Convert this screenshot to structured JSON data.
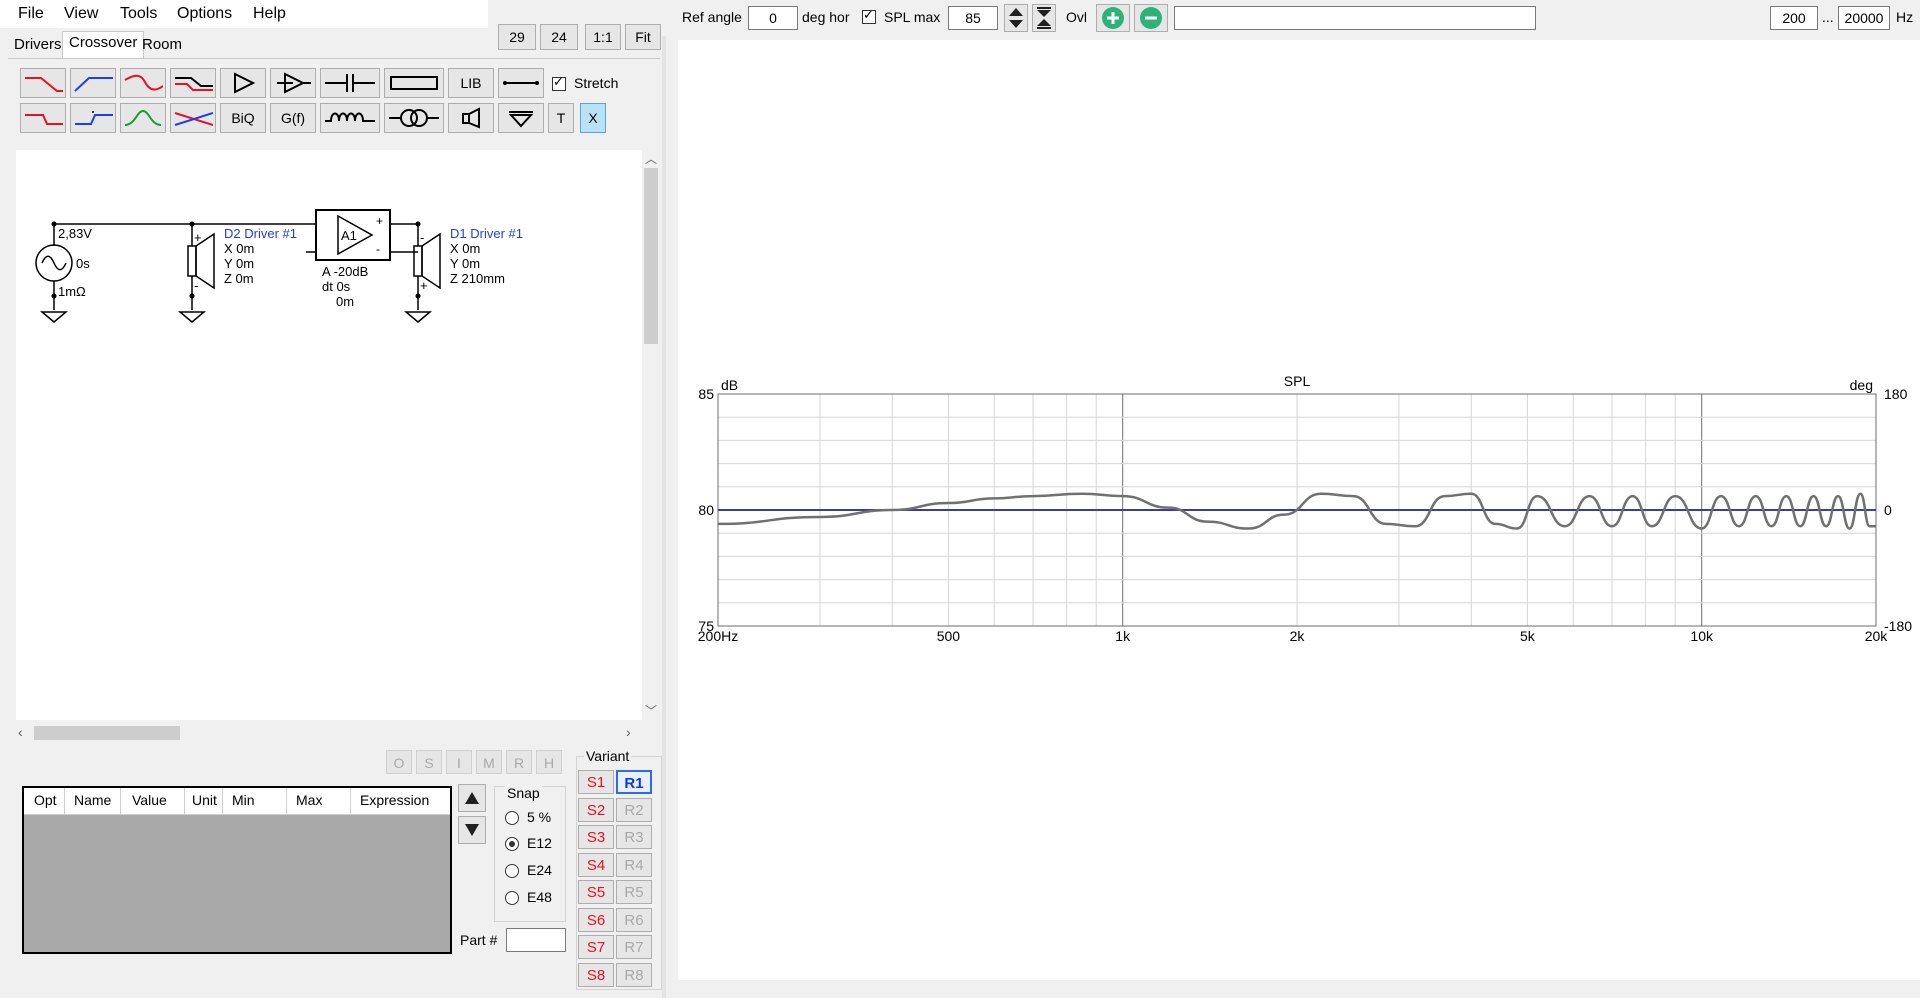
{
  "menu": [
    "File",
    "View",
    "Tools",
    "Options",
    "Help"
  ],
  "tabs": {
    "drivers": "Drivers",
    "crossover": "Crossover",
    "room": "Room"
  },
  "zoom": {
    "b1": "29",
    "b2": "24",
    "b3": "1:1",
    "b4": "Fit"
  },
  "toolbar": {
    "lib": "LIB",
    "biq": "BiQ",
    "gf": "G(f)",
    "t": "T",
    "x": "X",
    "stretch": "Stretch"
  },
  "schematic": {
    "source_v": "2,83V",
    "source_t": "0s",
    "source_r": "1mΩ",
    "d2_name": "D2 Driver #1",
    "d2_x": "X 0m",
    "d2_y": "Y 0m",
    "d2_z": "Z 0m",
    "amp_label": "A1",
    "amp_gain": "A  -20dB",
    "amp_dt": "dt 0s",
    "amp_d": "0m",
    "d1_name": "D1 Driver #1",
    "d1_x": "X 0m",
    "d1_y": "Y 0m",
    "d1_z": "Z 210mm",
    "plus": "+",
    "minus": "-"
  },
  "opt_buttons": [
    "O",
    "S",
    "I",
    "M",
    "R",
    "H"
  ],
  "parts_table": {
    "columns": [
      "Opt",
      "Name",
      "Value",
      "Unit",
      "Min",
      "Max",
      "Expression"
    ]
  },
  "snap": {
    "label": "Snap",
    "options": [
      "5 %",
      "E12",
      "E24",
      "E48"
    ],
    "selected": "E12",
    "part_label": "Part #"
  },
  "variant": {
    "label": "Variant",
    "s": [
      "S1",
      "S2",
      "S3",
      "S4",
      "S5",
      "S6",
      "S7",
      "S8"
    ],
    "r": [
      "R1",
      "R2",
      "R3",
      "R4",
      "R5",
      "R6",
      "R7",
      "R8"
    ],
    "active_r": "R1"
  },
  "topbar": {
    "ref_angle_label": "Ref angle",
    "ref_angle": "0",
    "deg_hor": "deg hor",
    "spl_max_label": "SPL max",
    "spl_max": "85",
    "ovl": "Ovl",
    "f_min": "200",
    "ellipsis": "...",
    "f_max": "20000",
    "hz": "Hz"
  },
  "chart_data": {
    "type": "line",
    "title": "SPL",
    "ylabel": "dB",
    "y2label": "deg",
    "x_scale": "log",
    "xlim": [
      200,
      20000
    ],
    "ylim": [
      75,
      85
    ],
    "y2lim": [
      -180,
      180
    ],
    "x_ticks": [
      {
        "v": 200,
        "l": "200Hz"
      },
      {
        "v": 500,
        "l": "500"
      },
      {
        "v": 1000,
        "l": "1k"
      },
      {
        "v": 2000,
        "l": "2k"
      },
      {
        "v": 5000,
        "l": "5k"
      },
      {
        "v": 10000,
        "l": "10k"
      },
      {
        "v": 20000,
        "l": "20k"
      }
    ],
    "y_ticks": [
      {
        "v": 85,
        "l": "85"
      },
      {
        "v": 80,
        "l": "80"
      },
      {
        "v": 75,
        "l": "75"
      }
    ],
    "y2_ticks": [
      {
        "v": 180,
        "l": "180"
      },
      {
        "v": 0,
        "l": "0"
      },
      {
        "v": -180,
        "l": "-180"
      }
    ],
    "grid": true,
    "series": [
      {
        "color": "#3a3aa8",
        "x": [
          200,
          20000
        ],
        "y": [
          80,
          80
        ]
      },
      {
        "color": "#707070",
        "x": [
          200,
          300,
          400,
          500,
          600,
          700,
          850,
          1000,
          1200,
          1400,
          1650,
          1900,
          2200,
          2500,
          2850,
          3200,
          3600,
          4000,
          4400,
          4800,
          5200,
          5800,
          6400,
          7000,
          7600,
          8200,
          9000,
          10000,
          10800,
          11600,
          12400,
          13200,
          14000,
          14800,
          15600,
          16400,
          17200,
          18000,
          18800,
          19500,
          20000
        ],
        "y": [
          79.4,
          79.7,
          80.0,
          80.3,
          80.5,
          80.6,
          80.7,
          80.6,
          80.1,
          79.5,
          79.2,
          79.8,
          80.7,
          80.6,
          79.4,
          79.3,
          80.6,
          80.7,
          79.4,
          79.2,
          80.6,
          79.3,
          80.6,
          79.3,
          80.6,
          79.3,
          80.6,
          79.2,
          80.6,
          79.3,
          80.6,
          79.3,
          80.6,
          79.3,
          80.6,
          79.3,
          80.6,
          79.2,
          80.7,
          79.3,
          79.3
        ]
      }
    ]
  }
}
